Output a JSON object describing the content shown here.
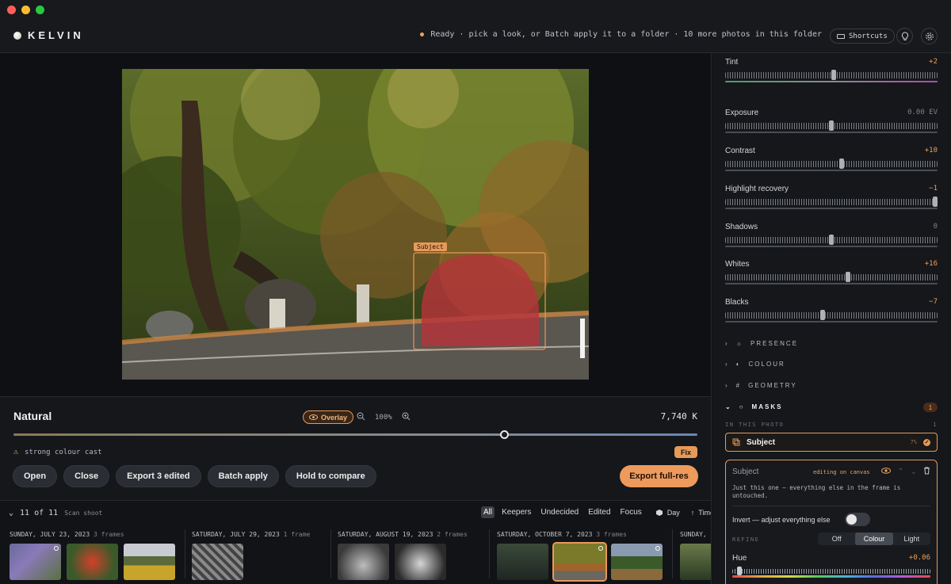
{
  "app": {
    "name": "KELVIN",
    "status": "Ready · pick a look, or Batch apply it to a folder · 10 more photos in this folder",
    "shortcuts_label": "Shortcuts"
  },
  "canvas": {
    "subject_tag": "Subject"
  },
  "controls": {
    "look_name": "Natural",
    "overlay_label": "Overlay",
    "zoom_level": "100%",
    "temperature": "7,740 K",
    "warning": "strong colour cast",
    "fix_label": "Fix",
    "buttons": [
      "Open",
      "Close",
      "Export 3 edited",
      "Batch apply",
      "Hold to compare"
    ],
    "export_label": "Export full-res"
  },
  "filmstrip": {
    "count": "11 of 11",
    "scan_label": "Scan shoot",
    "filters": [
      "All",
      "Keepers",
      "Undecided",
      "Edited",
      "Focus"
    ],
    "day_label": "Day",
    "time_label": "Time",
    "groups": [
      {
        "date": "SUNDAY, JULY 23, 2023",
        "frames": "3 frames"
      },
      {
        "date": "SATURDAY, JULY 29, 2023",
        "frames": "1 frame"
      },
      {
        "date": "SATURDAY, AUGUST 19, 2023",
        "frames": "2 frames"
      },
      {
        "date": "SATURDAY, OCTOBER 7, 2023",
        "frames": "3 frames"
      },
      {
        "date": "SUNDAY,",
        "frames": ""
      }
    ]
  },
  "panel": {
    "sliders": [
      {
        "label": "Tint",
        "value": "+2",
        "level": 0.51
      },
      {
        "label": "Exposure",
        "value": "0.00 EV",
        "level": 0.5
      },
      {
        "label": "Contrast",
        "value": "+10",
        "level": 0.55
      },
      {
        "label": "Highlight recovery",
        "value": "−1",
        "level": 0.99
      },
      {
        "label": "Shadows",
        "value": "0",
        "level": 0.5
      },
      {
        "label": "Whites",
        "value": "+16",
        "level": 0.58
      },
      {
        "label": "Blacks",
        "value": "−7",
        "level": 0.46
      }
    ],
    "sections": [
      "PRESENCE",
      "COLOUR",
      "GEOMETRY",
      "MASKS"
    ],
    "masks_count": "1",
    "in_this_photo": "IN THIS PHOTO",
    "in_this_photo_count": "1",
    "subject_item": "Subject",
    "subject_pct": "7%",
    "mask_card": {
      "title": "Subject",
      "editing": "editing on canvas",
      "description": "Just this one — everything else in the frame is untouched.",
      "invert_label": "Invert — adjust everything else",
      "refine_label": "REFINE",
      "refine_options": [
        "Off",
        "Colour",
        "Light"
      ],
      "hue_label": "Hue",
      "hue_value": "+0.06"
    }
  }
}
